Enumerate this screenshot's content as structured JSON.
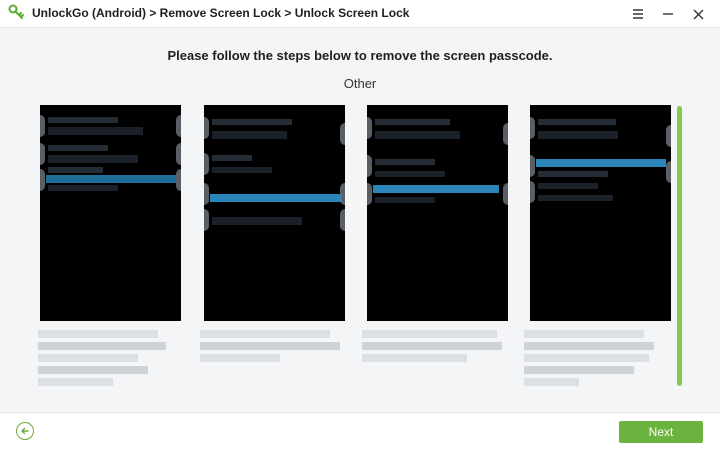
{
  "titlebar": {
    "breadcrumb": "UnlockGo (Android) > Remove Screen Lock > Unlock Screen Lock",
    "logo_icon": "unlockgo-logo-icon",
    "menu_icon": "hamburger-menu-icon",
    "minimize_icon": "minimize-icon",
    "close_icon": "close-icon"
  },
  "main": {
    "instruction": "Please follow the steps below to remove the screen passcode.",
    "subtitle": "Other",
    "steps": [
      {
        "name": "step-1",
        "image": "blurred-phone-screenshot"
      },
      {
        "name": "step-2",
        "image": "blurred-phone-screenshot"
      },
      {
        "name": "step-3",
        "image": "blurred-phone-screenshot"
      },
      {
        "name": "step-4",
        "image": "blurred-phone-screenshot"
      }
    ]
  },
  "footer": {
    "back_icon": "arrow-left-circle-icon",
    "next_label": "Next"
  },
  "colors": {
    "accent": "#6ab33e",
    "scrollbar": "#86c94f",
    "background": "#f4f5f7"
  }
}
